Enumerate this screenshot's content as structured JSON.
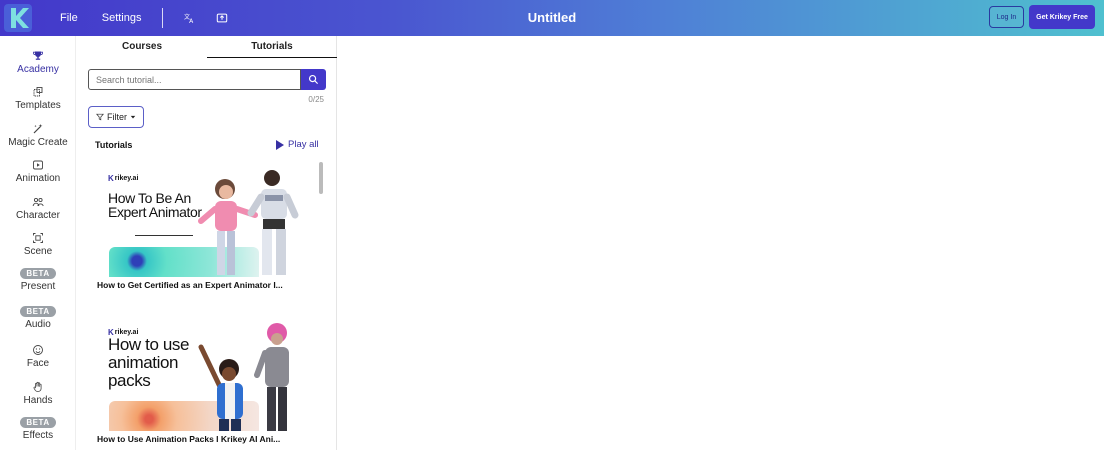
{
  "app": {
    "title": "Untitled",
    "brand_color": "#4338ca",
    "menu": {
      "file": "File",
      "settings": "Settings"
    },
    "toolbar_icons": [
      "translate-icon",
      "cloud-save-icon"
    ],
    "auth": {
      "login": "Log In",
      "get_free": "Get Krikey Free"
    }
  },
  "sidebar": {
    "items": [
      {
        "label": "Academy",
        "icon": "trophy-icon",
        "active": true
      },
      {
        "label": "Templates",
        "icon": "templates-icon"
      },
      {
        "label": "Magic Create",
        "icon": "magic-wand-icon"
      },
      {
        "label": "Animation",
        "icon": "play-icon"
      },
      {
        "label": "Character",
        "icon": "people-icon"
      },
      {
        "label": "Scene",
        "icon": "scene-icon"
      },
      {
        "label": "Present",
        "icon": "beta-badge",
        "badge": "BETA"
      },
      {
        "label": "Audio",
        "icon": "beta-badge",
        "badge": "BETA"
      },
      {
        "label": "Face",
        "icon": "face-icon"
      },
      {
        "label": "Hands",
        "icon": "hand-icon"
      },
      {
        "label": "Effects",
        "icon": "beta-badge",
        "badge": "BETA"
      }
    ]
  },
  "panel": {
    "tabs": {
      "courses": "Courses",
      "tutorials": "Tutorials"
    },
    "search": {
      "placeholder": "Search tutorial..."
    },
    "count": "0/25",
    "filter_label": "Filter",
    "section_label": "Tutorials",
    "play_all": "Play all",
    "cards": [
      {
        "brand": "rikey.ai",
        "headline_1": "How To Be An",
        "headline_2": "Expert Animator",
        "title": "How to Get Certified as an Expert Animator I..."
      },
      {
        "brand": "rikey.ai",
        "headline_1": "How to use",
        "headline_2": "animation",
        "headline_3": "packs",
        "title": "How to Use Animation Packs I Krikey AI Ani..."
      }
    ]
  }
}
